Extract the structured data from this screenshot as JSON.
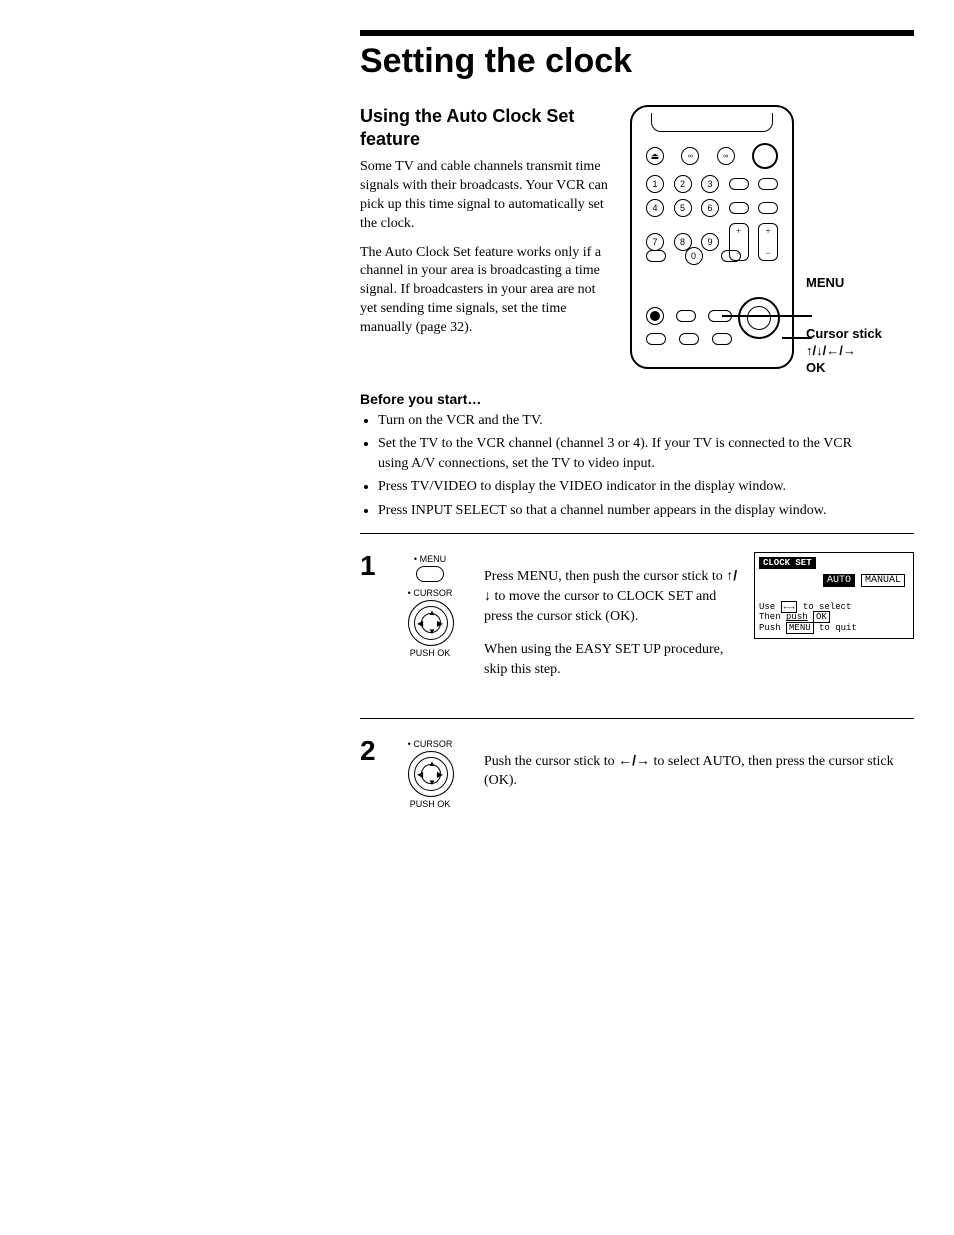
{
  "title": "Setting the clock",
  "section": {
    "heading": "Using the Auto Clock Set feature",
    "para1": "Some TV and cable channels transmit time signals with their broadcasts. Your VCR can pick up this time signal to automatically set the clock.",
    "para2": "The Auto Clock Set feature works only if a channel in your area is broadcasting a time signal. If broadcasters in your area are not yet sending time signals, set the time manually (page 32)."
  },
  "remote": {
    "callout_menu": "MENU",
    "callout_cursor1": "Cursor stick",
    "callout_cursor2": "↑/↓/←/→",
    "callout_cursor3": "OK",
    "keys": [
      "1",
      "2",
      "3",
      "4",
      "5",
      "6",
      "7",
      "8",
      "9",
      "0"
    ]
  },
  "before": {
    "heading": "Before you start…",
    "items": [
      "Turn on the VCR and the TV.",
      "Set the TV to the VCR channel (channel 3 or 4). If your TV is connected to the VCR using A/V connections, set the TV to video input.",
      "Press TV/VIDEO to display the VIDEO indicator in the display window.",
      "Press INPUT SELECT so that a channel number appears in the display window."
    ]
  },
  "step1": {
    "num": "1",
    "icon_menu": "• MENU",
    "icon_cursor": "• CURSOR",
    "push_ok": "PUSH OK",
    "text_a": "Press MENU, then push the cursor stick to ",
    "arrows1": "↑/↓",
    "text_b": " to move the cursor to CLOCK SET and press the cursor stick (OK).",
    "text_c": "When using the EASY SET UP procedure, skip this step."
  },
  "osd": {
    "title": "CLOCK SET",
    "opt_auto": "AUTO",
    "opt_manual": "MANUAL",
    "help1a": "Use ",
    "help1b": "←→",
    "help1c": " to select",
    "help2a": "Then ",
    "help2b": "push",
    "help2c": "OK",
    "help3a": "Push ",
    "help3b": "MENU",
    "help3c": " to quit"
  },
  "step2": {
    "num": "2",
    "icon_cursor": "• CURSOR",
    "push_ok": "PUSH OK",
    "text_a": "Push the cursor stick to ",
    "arrows": "←/→",
    "text_b": " to select AUTO, then press the cursor stick (OK)."
  }
}
